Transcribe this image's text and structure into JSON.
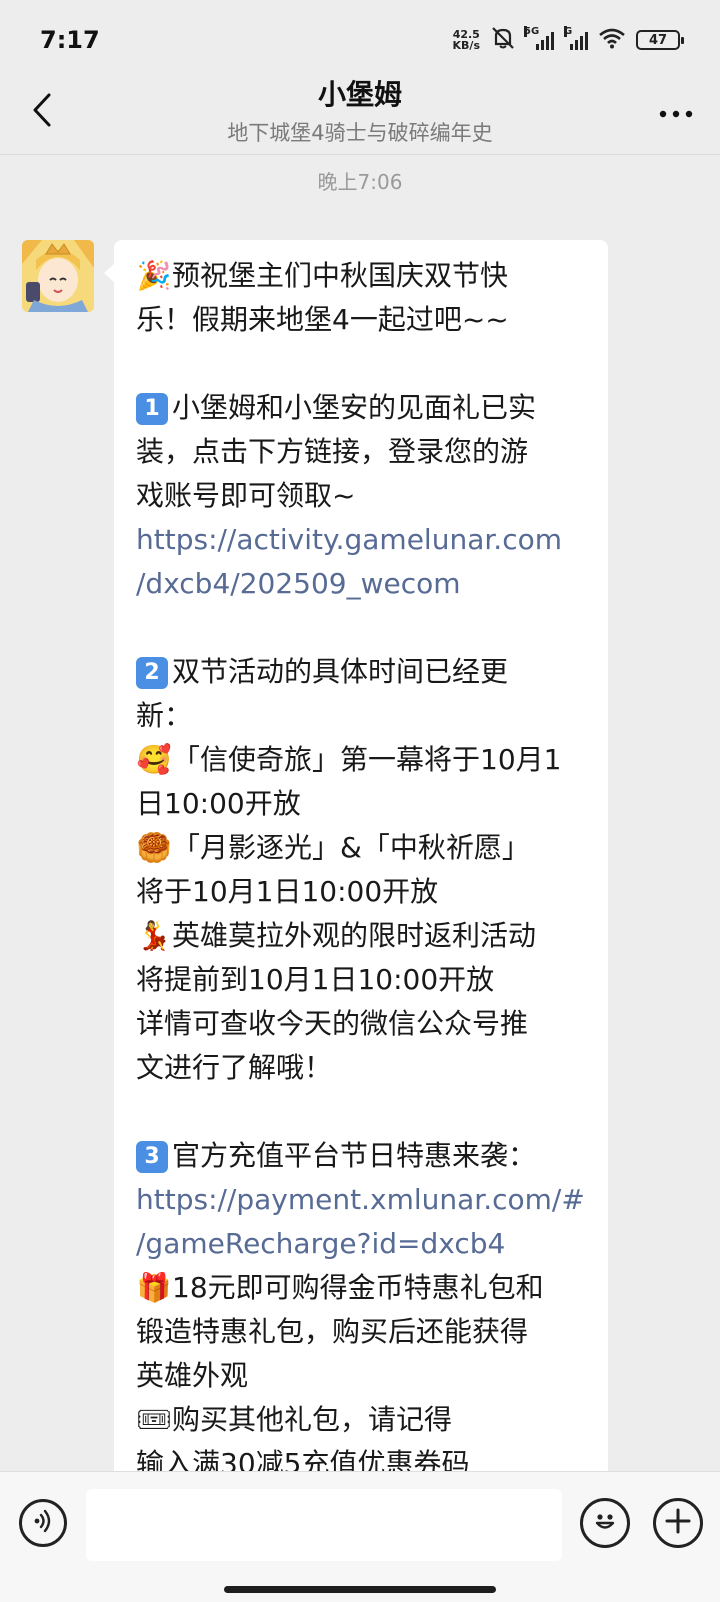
{
  "status_bar": {
    "time": "7:17",
    "net_speed_value": "42.5",
    "net_speed_unit": "KB/s",
    "sim1_label": "5G",
    "sim2_label": "G",
    "battery": "47"
  },
  "header": {
    "title": "小堡姆",
    "subtitle": "地下城堡4骑士与破碎编年史"
  },
  "chat": {
    "timestamp": "晚上7:06",
    "message": {
      "lines": [
        {
          "emoji": "🎉",
          "text": "预祝堡主们中秋国庆双节快"
        },
        {
          "text": "乐！假期来地堡4一起过吧~~"
        },
        {
          "text": ""
        },
        {
          "badge": "1",
          "text": "小堡姆和小堡安的见面礼已实"
        },
        {
          "text": "装，点击下方链接，登录您的游"
        },
        {
          "text": "戏账号即可领取~"
        },
        {
          "text": "https://activity.gamelunar.com",
          "link": true
        },
        {
          "text": "/dxcb4/202509_wecom",
          "link": true
        },
        {
          "text": ""
        },
        {
          "badge": "2",
          "text": "双节活动的具体时间已经更"
        },
        {
          "text": "新："
        },
        {
          "emoji": "🥰",
          "text": "「信使奇旅」第一幕将于10月1"
        },
        {
          "text": "日10:00开放"
        },
        {
          "emoji": "🥮",
          "text": "「月影逐光」&「中秋祈愿」"
        },
        {
          "text": "将于10月1日10:00开放"
        },
        {
          "emoji": "💃",
          "text": "英雄莫拉外观的限时返利活动"
        },
        {
          "text": "将提前到10月1日10:00开放"
        },
        {
          "text": "详情可查收今天的微信公众号推"
        },
        {
          "text": "文进行了解哦！"
        },
        {
          "text": ""
        },
        {
          "badge": "3",
          "text": "官方充值平台节日特惠来袭："
        },
        {
          "text": "https://payment.xmlunar.com/#",
          "link": true
        },
        {
          "text": "/gameRecharge?id=dxcb4",
          "link": true
        },
        {
          "emoji": "🎁",
          "text": "18元即可购得金币特惠礼包和"
        },
        {
          "text": "锻造特惠礼包，购买后还能获得"
        },
        {
          "text": "英雄外观"
        },
        {
          "emoji": "🎟",
          "text": "购买其他礼包，请记得"
        },
        {
          "text": "输入满30减5充值优惠券码"
        }
      ]
    }
  },
  "input_bar": {
    "input_value": "",
    "input_placeholder": ""
  },
  "icons": {
    "back": "chevron-left-icon",
    "more": "more-horizontal-icon",
    "voice": "voice-icon",
    "emoji": "smiley-icon",
    "plus": "plus-icon"
  }
}
